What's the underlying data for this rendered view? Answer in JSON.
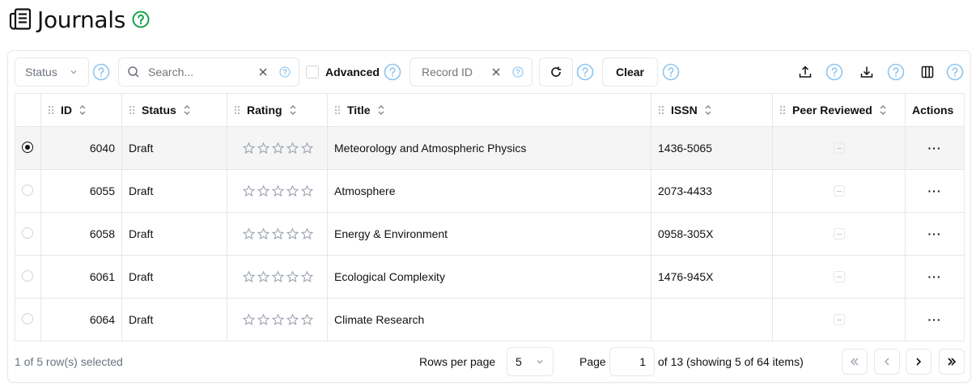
{
  "page": {
    "title": "Journals"
  },
  "colors": {
    "help_green": "#16a34a",
    "help_blue": "#8ec5f0"
  },
  "toolbar": {
    "status_placeholder": "Status",
    "search_placeholder": "Search...",
    "advanced_label": "Advanced",
    "record_id_placeholder": "Record ID",
    "clear_label": "Clear",
    "icons": [
      "refresh-icon",
      "upload-icon",
      "download-icon",
      "columns-icon"
    ]
  },
  "table": {
    "columns": [
      "ID",
      "Status",
      "Rating",
      "Title",
      "ISSN",
      "Peer Reviewed",
      "Actions"
    ],
    "rows": [
      {
        "id": "6040",
        "status": "Draft",
        "rating": 0,
        "title": "Meteorology and Atmospheric Physics",
        "issn": "1436-5065",
        "selected": true
      },
      {
        "id": "6055",
        "status": "Draft",
        "rating": 0,
        "title": "Atmosphere",
        "issn": "2073-4433",
        "selected": false
      },
      {
        "id": "6058",
        "status": "Draft",
        "rating": 0,
        "title": "Energy & Environment",
        "issn": "0958-305X",
        "selected": false
      },
      {
        "id": "6061",
        "status": "Draft",
        "rating": 0,
        "title": "Ecological Complexity",
        "issn": "1476-945X",
        "selected": false
      },
      {
        "id": "6064",
        "status": "Draft",
        "rating": 0,
        "title": "Climate Research",
        "issn": "",
        "selected": false
      }
    ],
    "actions_glyph": "···"
  },
  "footer": {
    "selection_text": "1 of 5 row(s) selected",
    "rows_per_page_label": "Rows per page",
    "rows_per_page_value": "5",
    "page_label": "Page",
    "page_value": "1",
    "of_text": "of 13 (showing 5 of 64 items)"
  }
}
